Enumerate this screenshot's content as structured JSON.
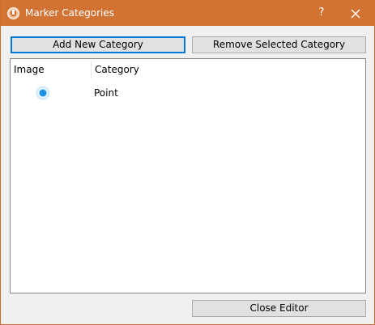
{
  "window": {
    "title": "Marker Categories",
    "help_label": "?",
    "titlebar_color": "#d27233"
  },
  "toolbar": {
    "add_label": "Add New Category",
    "remove_label": "Remove Selected Category"
  },
  "table": {
    "columns": [
      "Image",
      "Category"
    ],
    "rows": [
      {
        "icon": "point-marker-icon",
        "category": "Point"
      }
    ]
  },
  "footer": {
    "close_label": "Close Editor"
  },
  "colors": {
    "accent": "#0078d7",
    "marker": "#1e90e8"
  }
}
